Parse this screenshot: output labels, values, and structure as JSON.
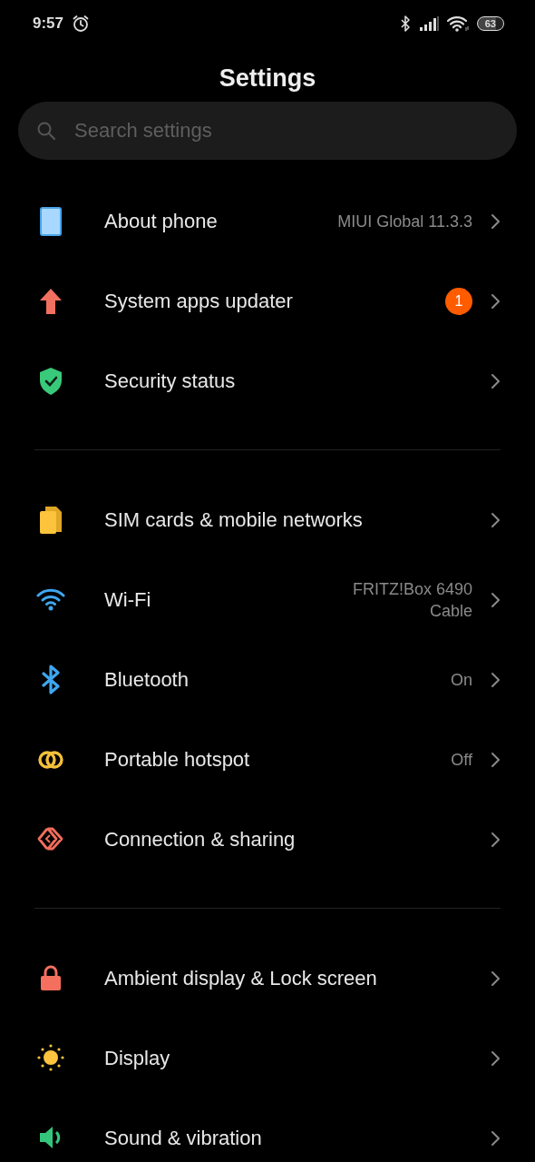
{
  "status_bar": {
    "time": "9:57",
    "battery": "63"
  },
  "title": "Settings",
  "search": {
    "placeholder": "Search settings"
  },
  "groups": [
    {
      "items": [
        {
          "label": "About phone",
          "value": "MIUI Global 11.3.3"
        },
        {
          "label": "System apps updater",
          "badge": "1"
        },
        {
          "label": "Security status"
        }
      ]
    },
    {
      "items": [
        {
          "label": "SIM cards & mobile networks"
        },
        {
          "label": "Wi-Fi",
          "value_lines": [
            "FRITZ!Box 6490",
            "Cable"
          ]
        },
        {
          "label": "Bluetooth",
          "value": "On"
        },
        {
          "label": "Portable hotspot",
          "value": "Off"
        },
        {
          "label": "Connection & sharing"
        }
      ]
    },
    {
      "items": [
        {
          "label": "Ambient display & Lock screen"
        },
        {
          "label": "Display"
        },
        {
          "label": "Sound & vibration"
        }
      ]
    }
  ]
}
